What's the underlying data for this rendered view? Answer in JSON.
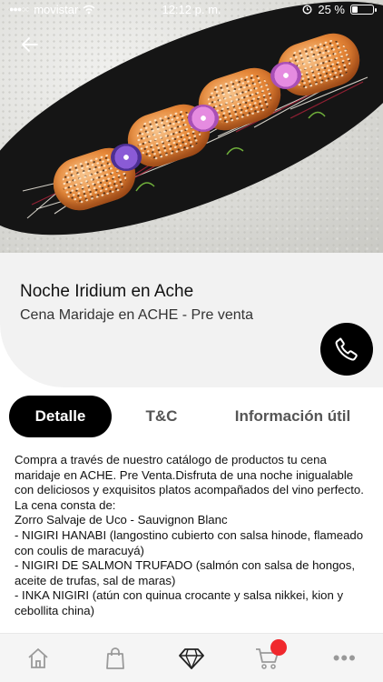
{
  "status_bar": {
    "carrier": "movistar",
    "time": "12:12 p. m.",
    "battery_text": "25 %",
    "battery_level": 0.25
  },
  "product": {
    "title": "Noche Iridium en Ache",
    "subtitle": "Cena Maridaje en ACHE - Pre venta"
  },
  "tabs": [
    {
      "label": "Detalle",
      "active": true
    },
    {
      "label": "T&C",
      "active": false
    },
    {
      "label": "Información útil",
      "active": false
    }
  ],
  "description": [
    "Compra a través de nuestro catálogo de productos tu cena maridaje en ACHE. Pre Venta.Disfruta de una noche inigualable con deliciosos y exquisitos platos acompañados del vino perfecto.",
    "La cena consta de:",
    "Zorro Salvaje de Uco - Sauvignon Blanc",
    "- NIGIRI HANABI (langostino cubierto con salsa hinode, flameado con coulis de maracuyá)",
    "- NIGIRI DE SALMON TRUFADO (salmón con salsa de hongos, aceite de trufas, sal de maras)",
    "- INKA NIGIRI (atún con quinua crocante y salsa nikkei, kion y cebollita china)"
  ],
  "bottom_nav": {
    "icons": [
      "home-icon",
      "shopping-bag-icon",
      "diamond-icon",
      "cart-icon",
      "more-icon"
    ],
    "cart_badge_color": "#f0282d",
    "more_label": "•••"
  },
  "colors": {
    "accent": "#000000",
    "badge": "#f0282d",
    "card_bg": "#f2f2f2"
  }
}
